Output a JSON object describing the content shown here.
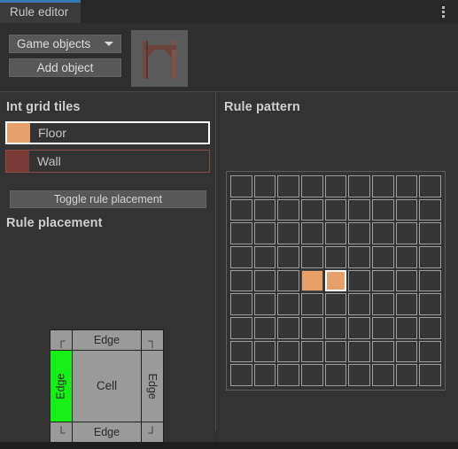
{
  "window": {
    "tabs": [
      {
        "label": "Rule editor",
        "active": true
      }
    ],
    "menu_icon": "kebab-menu-icon",
    "accent_color": "#3478b5"
  },
  "header": {
    "dropdown": {
      "label": "Game objects",
      "caret_icon": "chevron-down-icon"
    },
    "add_button": {
      "label": "Add object"
    },
    "thumbnail": {
      "name": "game-object-thumbnail",
      "alt": "wooden archway prop"
    }
  },
  "int_grid": {
    "title": "Int grid tiles",
    "tiles": [
      {
        "label": "Floor",
        "color": "#e8a06a",
        "selected": true
      },
      {
        "label": "Wall",
        "color": "#7a3a36",
        "selected": false
      }
    ],
    "toggle_button": {
      "label": "Toggle rule placement"
    }
  },
  "rule_placement": {
    "title": "Rule placement",
    "selected_color": "#16f016",
    "cells": [
      {
        "name": "corner-top-left",
        "label": "┌",
        "kind": "corner",
        "selected": false
      },
      {
        "name": "edge-top",
        "label": "Edge",
        "kind": "edge-h",
        "selected": false
      },
      {
        "name": "corner-top-right",
        "label": "┐",
        "kind": "corner",
        "selected": false
      },
      {
        "name": "edge-left",
        "label": "Edge",
        "kind": "edge-v-left",
        "selected": true
      },
      {
        "name": "cell-center",
        "label": "Cell",
        "kind": "center",
        "selected": false
      },
      {
        "name": "edge-right",
        "label": "Edge",
        "kind": "edge-v-right",
        "selected": false
      },
      {
        "name": "corner-bottom-left",
        "label": "└",
        "kind": "corner",
        "selected": false
      },
      {
        "name": "edge-bottom",
        "label": "Edge",
        "kind": "edge-h",
        "selected": false
      },
      {
        "name": "corner-bottom-right",
        "label": "┘",
        "kind": "corner",
        "selected": false
      }
    ]
  },
  "rule_pattern": {
    "title": "Rule pattern",
    "columns": 9,
    "rows": 9,
    "empty_color": "#363636",
    "fill_color": "#e8a06a",
    "cursor_color": "#ffffff",
    "filled_cells": [
      {
        "row": 4,
        "col": 3,
        "color": "#e8a06a",
        "cursor": false
      },
      {
        "row": 4,
        "col": 4,
        "color": "#e8a06a",
        "cursor": true
      }
    ]
  }
}
